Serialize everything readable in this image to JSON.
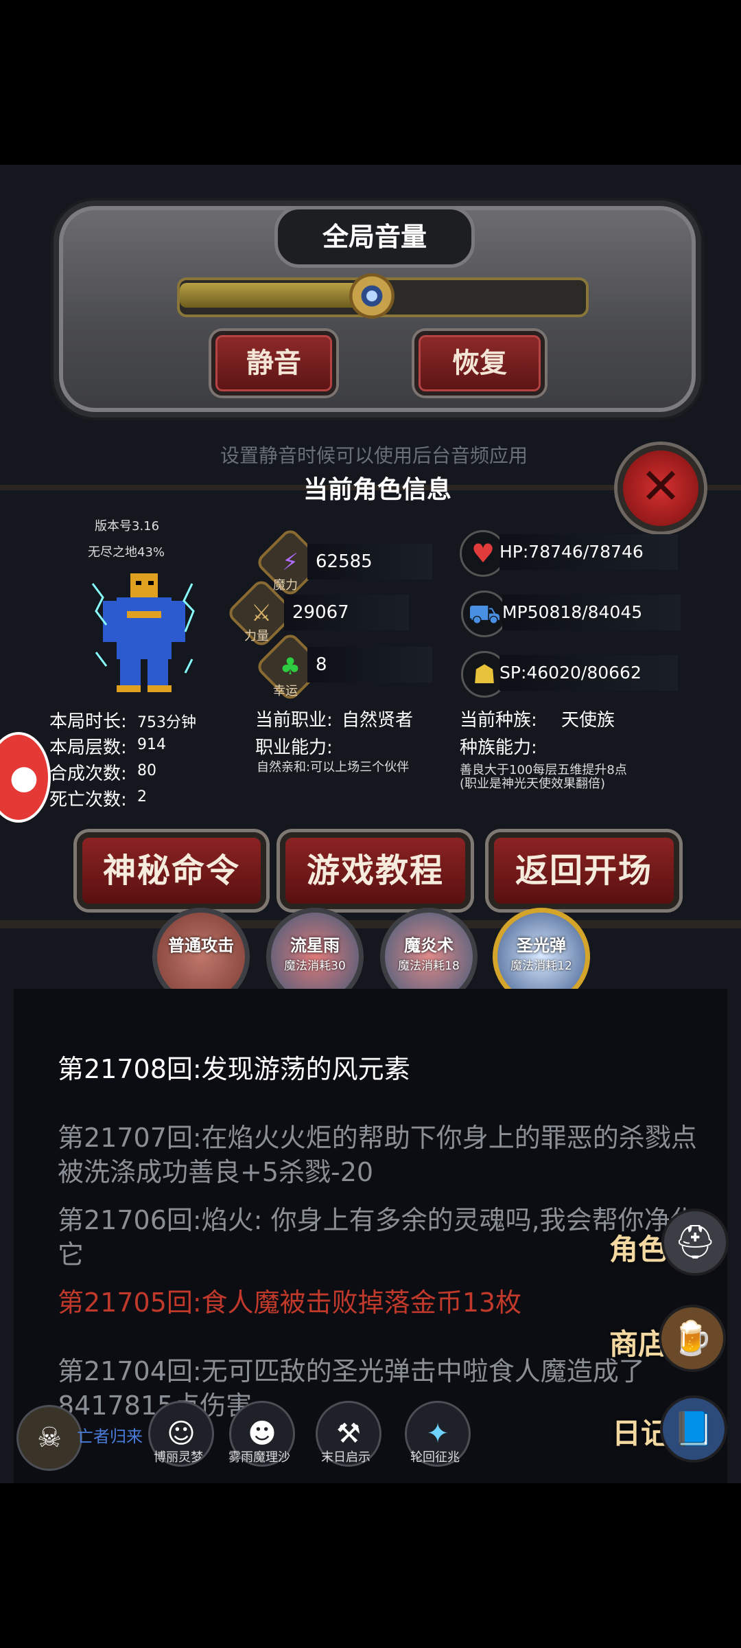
{
  "volume": {
    "title": "全局音量",
    "level": 0.48,
    "mute_label": "静音",
    "restore_label": "恢复",
    "hint": "设置静音时候可以使用后台音频应用"
  },
  "info": {
    "title": "当前角色信息",
    "version": "版本号3.16",
    "world": "无尽之地43%",
    "stats": {
      "magic": {
        "label": "魔力",
        "value": "62585"
      },
      "strength": {
        "label": "力量",
        "value": "29067"
      },
      "luck": {
        "label": "幸运",
        "value": "8"
      }
    },
    "hp": "HP:78746/78746",
    "mp": "MP50818/84045",
    "sp": "SP:46020/80662",
    "play_time_label": "本局时长:",
    "play_time": "753分钟",
    "floors_label": "本局层数:",
    "floors": "914",
    "merges_label": "合成次数:",
    "merges": "80",
    "deaths_label": "死亡次数:",
    "deaths": "2",
    "job_label": "当前职业:",
    "job": "自然贤者",
    "job_ability_label": "职业能力:",
    "job_ability": "自然亲和:可以上场三个伙伴",
    "race_label": "当前种族:",
    "race": "天使族",
    "race_ability_label": "种族能力:",
    "race_ability": "善良大于100每层五维提升8点(职业是神光天使效果翻倍)"
  },
  "menu": {
    "secret_cmd": "神秘命令",
    "tutorial": "游戏教程",
    "back": "返回开场"
  },
  "skills": [
    {
      "name": "普通攻击",
      "cost": ""
    },
    {
      "name": "流星雨",
      "cost": "魔法消耗30"
    },
    {
      "name": "魔炎术",
      "cost": "魔法消耗18"
    },
    {
      "name": "圣光弹",
      "cost": "魔法消耗12"
    }
  ],
  "log": [
    "第21708回:发现游荡的风元素",
    "第21707回:在焰火火炬的帮助下你身上的罪恶的杀戮点被洗涤成功善良+5杀戮-20",
    "第21706回:焰火: 你身上有多余的灵魂吗,我会帮你净化它",
    "第21705回:食人魔被击败掉落金币13枚",
    "第21704回:无可匹敌的圣光弹击中啦食人魔造成了8417815点伤害"
  ],
  "side": {
    "character": "角色",
    "shop": "商店",
    "diary": "日记"
  },
  "party": {
    "leader": "亡者归来",
    "members": [
      "博丽灵梦",
      "雾雨魔理沙",
      "末日启示",
      "轮回征兆"
    ]
  },
  "colors": {
    "accent_red": "#8b2323",
    "gold": "#c7a24b",
    "log_red": "#c0392b",
    "log_gray": "#8a8f96"
  }
}
